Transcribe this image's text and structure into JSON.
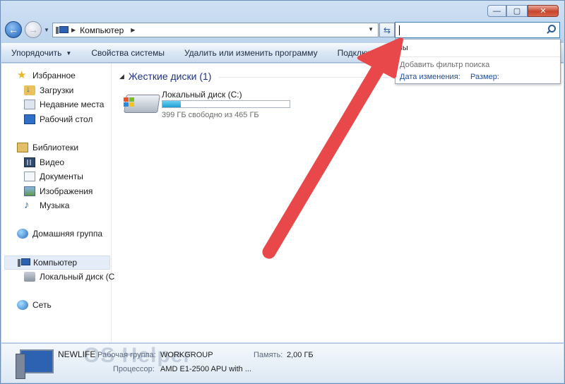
{
  "window": {
    "caption": {
      "minimize": "—",
      "maximize": "▢",
      "close": "✕"
    }
  },
  "address": {
    "crumbs": [
      "Компьютер"
    ],
    "refresh_icon": "refresh-icon",
    "search_value": ""
  },
  "search_dropdown": {
    "heading": "вы",
    "add_filter": "Добавить фильтр поиска",
    "filters": [
      "Дата изменения:",
      "Размер:"
    ]
  },
  "toolbar": {
    "organize": "Упорядочить",
    "system_props": "Свойства системы",
    "uninstall": "Удалить или изменить программу",
    "connect": "Подключить сетевой диск"
  },
  "nav": {
    "favorites": "Избранное",
    "downloads": "Загрузки",
    "recent": "Недавние места",
    "desktop": "Рабочий стол",
    "libraries": "Библиотеки",
    "video": "Видео",
    "documents": "Документы",
    "images": "Изображения",
    "music": "Музыка",
    "homegroup": "Домашняя группа",
    "computer": "Компьютер",
    "local_disk": "Локальный диск (С",
    "network": "Сеть"
  },
  "content": {
    "group_title": "Жесткие диски (1)",
    "drive": {
      "name": "Локальный диск (C:)",
      "used_fraction": 0.142,
      "free_text": "399 ГБ свободно из 465 ГБ"
    }
  },
  "details": {
    "name": "NEWLIFE",
    "workgroup_label": "Рабочая группа:",
    "workgroup_value": "WORKGROUP",
    "memory_label": "Память:",
    "memory_value": "2,00 ГБ",
    "cpu_label": "Процессор:",
    "cpu_value": "AMD E1-2500 APU with ...",
    "watermark": "OS Helper"
  },
  "colors": {
    "accent": "#1e3287",
    "arrow": "#e8484a",
    "drive_fill": "#1e9fd4"
  }
}
